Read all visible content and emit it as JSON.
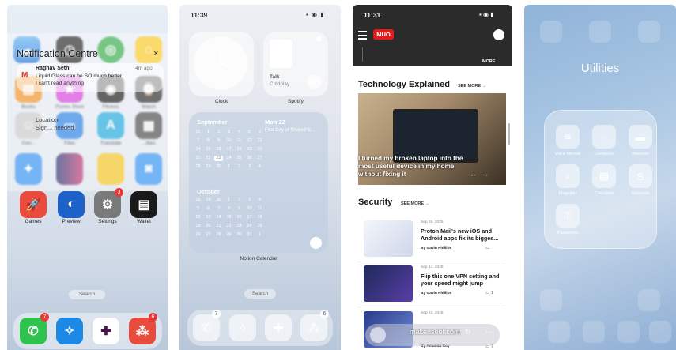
{
  "phone1": {
    "notification_centre_title": "Notification Centre",
    "close_glyph": "×",
    "notification": {
      "sender": "Raghav Sethi",
      "line1": "Liquid Glass can be SO much better",
      "line2": "I can't read anything",
      "time": "4m ago"
    },
    "location_line1": "Location",
    "location_line2": "Sign... needed",
    "apps_row2": [
      "Books",
      "iTunes Store",
      "Fitness",
      "Watch"
    ],
    "apps_row3": [
      "Con...",
      "Files",
      "Translate",
      "...ities"
    ],
    "apps_row5": [
      "Games",
      "Preview",
      "Settings",
      "Wallet"
    ],
    "settings_badge": "3",
    "search_label": "Search",
    "dock_badges": [
      "7",
      "6"
    ]
  },
  "phone2": {
    "status_time": "11:39",
    "status_icons": "▪ ◉ ▮",
    "clock_label": "Clock",
    "spotify_label": "Spotify",
    "spotify_track": "Talk",
    "spotify_artist": "Coldplay",
    "cal_month1": "September",
    "cal_date_header": "Mon 22",
    "cal_event": "First Day of Shared N...",
    "cal_month1_days": [
      "31",
      "1",
      "2",
      "3",
      "4",
      "5",
      "6",
      "7",
      "8",
      "9",
      "10",
      "11",
      "12",
      "13",
      "14",
      "15",
      "16",
      "17",
      "18",
      "19",
      "20",
      "21",
      "22",
      "23",
      "24",
      "25",
      "26",
      "27",
      "28",
      "29",
      "30",
      "1",
      "2",
      "3",
      "4"
    ],
    "cal_today_index": 23,
    "cal_month2": "October",
    "cal_month2_days": [
      "28",
      "29",
      "30",
      "1",
      "2",
      "3",
      "4",
      "5",
      "6",
      "7",
      "8",
      "9",
      "10",
      "11",
      "12",
      "13",
      "14",
      "15",
      "16",
      "17",
      "18",
      "19",
      "20",
      "21",
      "22",
      "23",
      "24",
      "25",
      "26",
      "27",
      "28",
      "29",
      "30",
      "31",
      "1"
    ],
    "calendar_label": "Notion Calendar",
    "search_label": "Search",
    "dock_badges": [
      "7",
      "6"
    ]
  },
  "phone3": {
    "status_time": "11:31",
    "status_icons": "▪ ◉ ▮",
    "logo": "MUO",
    "more_top": "MORE",
    "section1_title": "Technology Explained",
    "see_more": "SEE MORE",
    "see_more_arrow": "→",
    "hero_title": "I turned my broken laptop into the most useful device in my home without fixing it",
    "hero_prev": "←",
    "hero_next": "→",
    "section2_title": "Security",
    "articles": [
      {
        "date": "Sep 26, 2025",
        "title": "Proton Mail's new iOS and Android apps fix its bigges...",
        "byline": "By Gavin Phillips",
        "comments": ""
      },
      {
        "date": "Sep 14, 2025",
        "title": "Flip this one VPN setting and your speed might jump",
        "byline": "By Gavin Phillips",
        "comments": "1"
      },
      {
        "date": "Sep 22, 2025",
        "title": "",
        "byline": "By Amanda Roy",
        "comments": "7"
      }
    ],
    "url": "makeuseof.com"
  },
  "phone4": {
    "folder_title": "Utilities",
    "apps": [
      "Voice Memos",
      "Compass",
      "Measure",
      "Magnifier",
      "Calculator",
      "Shortcuts",
      "Passwords"
    ]
  }
}
